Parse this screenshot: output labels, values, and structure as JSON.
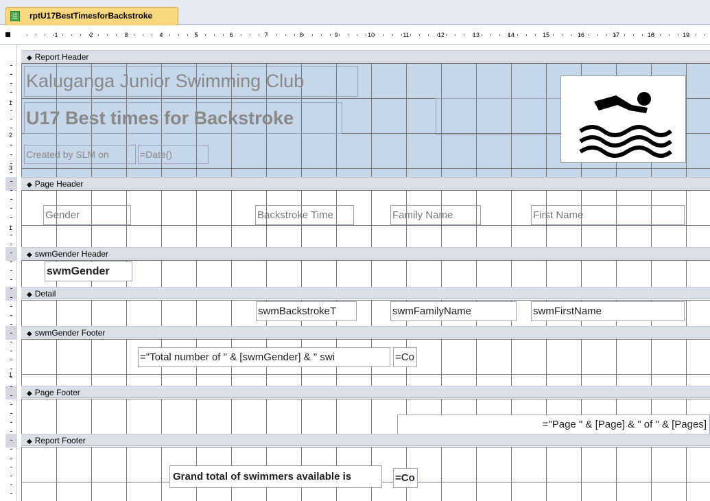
{
  "tab": {
    "title": "rptU17BestTimesforBackstroke"
  },
  "ruler": {
    "labels": [
      "1",
      "2",
      "3",
      "4",
      "5",
      "6",
      "7",
      "8",
      "9",
      "10",
      "11",
      "12",
      "13",
      "14",
      "15",
      "16",
      "17",
      "18",
      "19"
    ]
  },
  "vruler": {
    "labels": [
      "1",
      "2",
      "3",
      "1",
      "1"
    ]
  },
  "sections": {
    "report_header": "Report Header",
    "page_header": "Page Header",
    "gender_header": "swmGender Header",
    "detail": "Detail",
    "gender_footer": "swmGender Footer",
    "page_footer": "Page Footer",
    "report_footer": "Report Footer"
  },
  "report_header": {
    "club_title": "Kaluganga Junior Swimming Club",
    "report_title": "U17 Best times for Backstroke",
    "created_label": "Created by SLM on",
    "date_expr": "=Date()",
    "logo_icon": "swimmer-icon"
  },
  "page_header": {
    "gender": "Gender",
    "backstroke_time": "Backstroke Time",
    "family_name": "Family Name",
    "first_name": "First Name"
  },
  "gender_header": {
    "field": "swmGender"
  },
  "detail": {
    "backstroke": "swmBackstrokeT",
    "family": "swmFamilyName",
    "first": "swmFirstName"
  },
  "gender_footer": {
    "total_expr": "=\"Total number of \" & [swmGender] & \" swi",
    "count_expr": "=Co"
  },
  "page_footer": {
    "page_expr": "=\"Page \" & [Page] & \" of \" & [Pages]"
  },
  "report_footer": {
    "grand_label": "Grand total of swimmers available is",
    "count_expr": "=Co"
  },
  "colors": {
    "tab": "#f9d77e",
    "header_bg": "#c6d7ea",
    "band": "#dbdfe7"
  }
}
